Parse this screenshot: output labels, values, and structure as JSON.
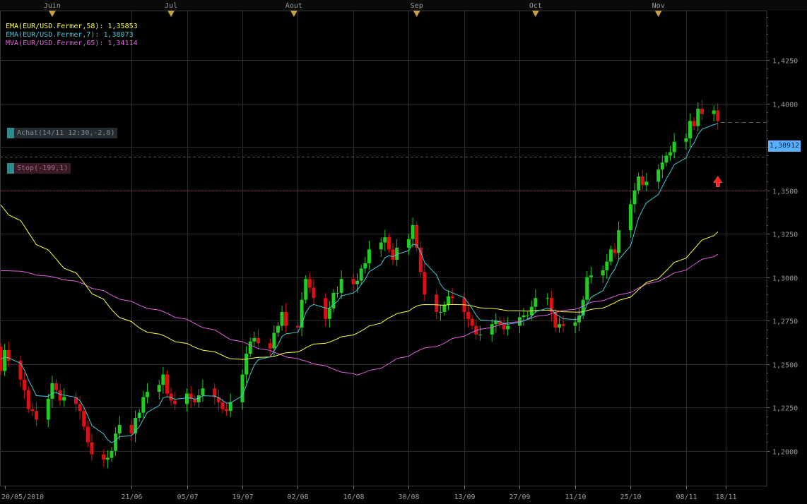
{
  "chart_data": {
    "type": "candlestick",
    "symbol": "EUR/USD",
    "months": [
      {
        "label": "Juin",
        "date": "2010-06-01"
      },
      {
        "label": "Jul",
        "date": "2010-07-01"
      },
      {
        "label": "Aout",
        "date": "2010-08-01"
      },
      {
        "label": "Sep",
        "date": "2010-09-01"
      },
      {
        "label": "Oct",
        "date": "2010-10-01"
      },
      {
        "label": "Nov",
        "date": "2010-11-01"
      }
    ],
    "x_ticks": [
      {
        "label": "20/05/2010",
        "date": "2010-05-20"
      },
      {
        "label": "21/06",
        "date": "2010-06-21"
      },
      {
        "label": "05/07",
        "date": "2010-07-05"
      },
      {
        "label": "19/07",
        "date": "2010-07-19"
      },
      {
        "label": "02/08",
        "date": "2010-08-02"
      },
      {
        "label": "16/08",
        "date": "2010-08-16"
      },
      {
        "label": "30/08",
        "date": "2010-08-30"
      },
      {
        "label": "13/09",
        "date": "2010-09-13"
      },
      {
        "label": "27/09",
        "date": "2010-09-27"
      },
      {
        "label": "11/10",
        "date": "2010-10-11"
      },
      {
        "label": "25/10",
        "date": "2010-10-25"
      },
      {
        "label": "08/11",
        "date": "2010-11-08"
      },
      {
        "label": "18/11",
        "date": "2010-11-18"
      }
    ],
    "y_ticks": [
      "1,2000",
      "1,2250",
      "1,2500",
      "1,2750",
      "1,3000",
      "1,3250",
      "1,3500",
      "1,3750",
      "1,4000",
      "1,4250"
    ],
    "y_tick_values": [
      1.2,
      1.225,
      1.25,
      1.275,
      1.3,
      1.325,
      1.35,
      1.375,
      1.4,
      1.425
    ],
    "ylim": [
      1.18,
      1.4535
    ],
    "grid": true,
    "candle_dates": [
      "2010-05-19",
      "2010-11-16"
    ],
    "closes": [
      1.246,
      1.258,
      1.252,
      1.241,
      1.235,
      1.224,
      1.223,
      1.218,
      1.23,
      1.239,
      1.235,
      1.229,
      1.231,
      1.227,
      1.223,
      1.214,
      1.205,
      1.198,
      1.195,
      1.196,
      1.2,
      1.21,
      1.215,
      1.21,
      1.219,
      1.222,
      1.231,
      1.234,
      1.238,
      1.244,
      1.233,
      1.229,
      1.227,
      1.233,
      1.23,
      1.228,
      1.232,
      1.236,
      1.231,
      1.228,
      1.224,
      1.223,
      1.228,
      1.244,
      1.256,
      1.263,
      1.265,
      1.262,
      1.259,
      1.268,
      1.272,
      1.28,
      1.272,
      1.271,
      1.287,
      1.299,
      1.294,
      1.288,
      1.276,
      1.282,
      1.291,
      1.291,
      1.299,
      1.296,
      1.298,
      1.305,
      1.308,
      1.316,
      1.32,
      1.323,
      1.316,
      1.31,
      1.317,
      1.322,
      1.33,
      1.317,
      1.303,
      1.29,
      1.28,
      1.28,
      1.284,
      1.289,
      1.288,
      1.28,
      1.276,
      1.272,
      1.267,
      1.267,
      1.273,
      1.275,
      1.273,
      1.27,
      1.272,
      1.277,
      1.278,
      1.278,
      1.283,
      1.288,
      1.288,
      1.28,
      1.271,
      1.273,
      1.272,
      1.274,
      1.278,
      1.287,
      1.3,
      1.301,
      1.304,
      1.309,
      1.316,
      1.314,
      1.327,
      1.342,
      1.35,
      1.358,
      1.353,
      1.355,
      1.362,
      1.366,
      1.37,
      1.372,
      1.378,
      1.38,
      1.39,
      1.387,
      1.397,
      1.394,
      1.396,
      1.39,
      1.392,
      1.398,
      1.404,
      1.401,
      1.393,
      1.384,
      1.395,
      1.393,
      1.394,
      1.396,
      1.393,
      1.387,
      1.382,
      1.394,
      1.388,
      1.39,
      1.39,
      1.388,
      1.397,
      1.405,
      1.41,
      1.417,
      1.418,
      1.407,
      1.403,
      1.396,
      1.387,
      1.378,
      1.368,
      1.362,
      1.37,
      1.369
    ],
    "series": [
      {
        "name": "EMA(EUR/USD.Fermer,58)",
        "color": "#ffff44",
        "last_value": 1.35853,
        "legend": "EMA(EUR/USD.Fermer,58): 1,35853"
      },
      {
        "name": "EMA(EUR/USD.Fermer,7)",
        "color": "#44c8d8",
        "last_value": 1.38073,
        "legend": "EMA(EUR/USD.Fermer,7): 1,38073"
      },
      {
        "name": "MVA(EUR/USD.Fermer,65)",
        "color": "#e060e0",
        "last_value": 1.34114,
        "legend": "MVA(EUR/USD.Fermer,65): 1,34114"
      }
    ],
    "current_price": 1.38912,
    "current_price_label": "1,38912",
    "orders": [
      {
        "label": "Achat(14/11 12:30,-2,8)",
        "level": 1.3695
      },
      {
        "label": "Stop(-199,1)",
        "level": 1.35
      }
    ]
  }
}
